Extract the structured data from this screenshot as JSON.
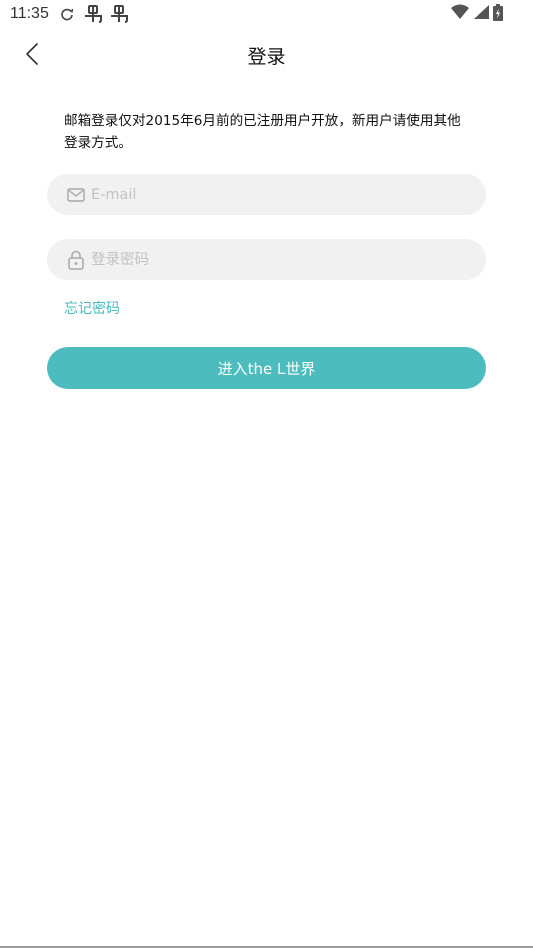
{
  "status_bar": {
    "time": "11:35"
  },
  "nav": {
    "title": "登录"
  },
  "login": {
    "notice": "邮箱登录仅对2015年6月前的已注册用户开放，新用户请使用其他登录方式。",
    "email_placeholder": "E-mail",
    "email_value": "",
    "password_placeholder": "登录密码",
    "password_value": "",
    "forgot_label": "忘记密码",
    "enter_label": "进入the L世界"
  },
  "colors": {
    "accent": "#4cbcbf",
    "field_bg": "#f1f1f1",
    "placeholder": "#c2c2c2"
  }
}
